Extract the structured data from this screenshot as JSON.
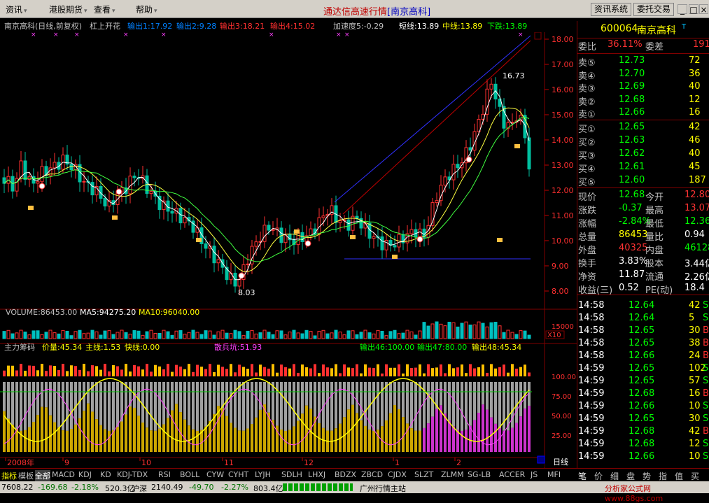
{
  "menubar": {
    "items": [
      "资讯",
      "港股期货",
      "查看",
      "帮助"
    ],
    "app_title": "通达信高速行情",
    "title_stock": "[南京高科]",
    "btn_info": "资讯系统",
    "btn_trade": "委托交易"
  },
  "header": {
    "stock_label": "南京高科(日线,前复权)",
    "formula": "杠上开花",
    "out1": "输出1:17.92",
    "out2": "输出2:9.28",
    "out3": "输出3:18.21",
    "out4": "输出4:15.02",
    "accel": "加速度5:-0.29",
    "short": "短线:13.89",
    "mid": "中线:13.89",
    "down": "下跌:13.89"
  },
  "volume_header": {
    "vol": "VOLUME:86453.00",
    "ma5": "MA5:94275.20",
    "ma10": "MA10:96040.00"
  },
  "indicator_header": {
    "name": "主力筹码",
    "price": "价量:45.34",
    "main": "主线:1.53",
    "fast": "快线:0.00",
    "retail": "散兵坑:51.93",
    "o46": "输出46:100.00",
    "o47": "输出47:80.00",
    "o48": "输出48:45.34"
  },
  "chart_data": {
    "type": "candlestick",
    "y_ticks": [
      "18.00",
      "17.00",
      "16.00",
      "15.00",
      "14.00",
      "13.00",
      "12.00",
      "11.00",
      "10.00",
      "9.00",
      "8.00"
    ],
    "vol_ticks": [
      "15000"
    ],
    "vol_unit": "X10",
    "ind_ticks": [
      "100.00",
      "75.00",
      "50.00",
      "25.00"
    ],
    "x_labels": [
      "2008年",
      "9",
      "10",
      "11",
      "12",
      "1",
      "2"
    ],
    "annotations": {
      "high": "16.73",
      "low": "8.03"
    },
    "ylim": [
      7.6,
      18.4
    ]
  },
  "quote": {
    "code": "600064",
    "name": "南京高科",
    "badge": "T",
    "wb_label": "委比",
    "wb_val": "36.11%",
    "wc_label": "委差",
    "wc_val": "191",
    "sell": [
      {
        "label": "卖⑤",
        "price": "12.73",
        "vol": "72"
      },
      {
        "label": "卖④",
        "price": "12.70",
        "vol": "36"
      },
      {
        "label": "卖③",
        "price": "12.69",
        "vol": "40"
      },
      {
        "label": "卖②",
        "price": "12.68",
        "vol": "12"
      },
      {
        "label": "卖①",
        "price": "12.66",
        "vol": "16"
      }
    ],
    "buy": [
      {
        "label": "买①",
        "price": "12.65",
        "vol": "42"
      },
      {
        "label": "买②",
        "price": "12.63",
        "vol": "46"
      },
      {
        "label": "买③",
        "price": "12.62",
        "vol": "40"
      },
      {
        "label": "买④",
        "price": "12.61",
        "vol": "45"
      },
      {
        "label": "买⑤",
        "price": "12.60",
        "vol": "187"
      }
    ],
    "stats": [
      {
        "l1": "现价",
        "v1": "12.68",
        "c1": "#00ff00",
        "l2": "今开",
        "v2": "12.80",
        "c2": "#ff3333"
      },
      {
        "l1": "涨跌",
        "v1": "-0.37",
        "c1": "#00ff00",
        "l2": "最高",
        "v2": "13.07",
        "c2": "#ff3333"
      },
      {
        "l1": "涨幅",
        "v1": "-2.84%",
        "c1": "#00ff00",
        "l2": "最低",
        "v2": "12.36",
        "c2": "#00ff00"
      },
      {
        "l1": "总量",
        "v1": "86453",
        "c1": "#ffff00",
        "l2": "量比",
        "v2": "0.94",
        "c2": "#ffffff"
      },
      {
        "l1": "外盘",
        "v1": "40325",
        "c1": "#ff3333",
        "l2": "内盘",
        "v2": "46128",
        "c2": "#00ff00"
      },
      {
        "l1": "换手",
        "v1": "3.83%",
        "c1": "#ffffff",
        "l2": "股本",
        "v2": "3.44亿",
        "c2": "#ffffff"
      },
      {
        "l1": "净资",
        "v1": "11.87",
        "c1": "#ffffff",
        "l2": "流通",
        "v2": "2.26亿",
        "c2": "#ffffff"
      },
      {
        "l1": "收益(三)",
        "v1": "0.52",
        "c1": "#ffffff",
        "l2": "PE(动)",
        "v2": "18.4",
        "c2": "#ffffff"
      }
    ],
    "ticks": [
      {
        "t": "14:58",
        "p": "12.64",
        "v": "42",
        "d": "S"
      },
      {
        "t": "14:58",
        "p": "12.64",
        "v": "5",
        "d": "S"
      },
      {
        "t": "14:58",
        "p": "12.65",
        "v": "30",
        "d": "B"
      },
      {
        "t": "14:58",
        "p": "12.65",
        "v": "38",
        "d": "B"
      },
      {
        "t": "14:58",
        "p": "12.66",
        "v": "24",
        "d": "B"
      },
      {
        "t": "14:59",
        "p": "12.65",
        "v": "102",
        "d": "S"
      },
      {
        "t": "14:59",
        "p": "12.65",
        "v": "57",
        "d": "S"
      },
      {
        "t": "14:59",
        "p": "12.68",
        "v": "16",
        "d": "B"
      },
      {
        "t": "14:59",
        "p": "12.66",
        "v": "10",
        "d": "S"
      },
      {
        "t": "14:59",
        "p": "12.65",
        "v": "30",
        "d": "S"
      },
      {
        "t": "14:59",
        "p": "12.68",
        "v": "42",
        "d": "B"
      },
      {
        "t": "14:59",
        "p": "12.68",
        "v": "12",
        "d": "S"
      },
      {
        "t": "14:59",
        "p": "12.66",
        "v": "10",
        "d": "S"
      }
    ]
  },
  "tabs": [
    "指标",
    "模板",
    "全部",
    "MACD",
    "KDJ",
    "KD",
    "KDJ-TDX",
    "RSI",
    "BOLL",
    "CYW",
    "CYHT",
    "LYJH",
    "SDLH",
    "LHXJ",
    "BDZX",
    "ZBCD",
    "CJDX",
    "SLZT",
    "ZLMM",
    "SG-LB",
    "ACCER",
    "JS",
    "MFI"
  ],
  "period": "日线",
  "right_tabs": [
    "笔",
    "价",
    "细",
    "盘",
    "势",
    "指",
    "值",
    "买"
  ],
  "statusbar": {
    "idx1": "7608.22",
    "chg1": "-169.68",
    "pct1": "-2.18%",
    "amt1": "520.3亿",
    "name2": "沪深",
    "idx2": "2140.49",
    "chg2": "-49.70",
    "pct2": "-2.27%",
    "amt2": "803.4亿",
    "station": "广州行情主站",
    "watermark": "分析家公式网www.88gs.com"
  }
}
